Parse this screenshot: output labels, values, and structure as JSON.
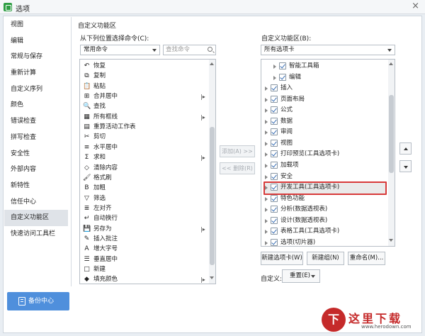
{
  "window": {
    "title": "选项",
    "close_glyph": "×"
  },
  "sidebar": {
    "items": [
      "视图",
      "编辑",
      "常规与保存",
      "重新计算",
      "自定义序列",
      "颜色",
      "错误检查",
      "拼写检查",
      "安全性",
      "外部内容",
      "新特性",
      "信任中心",
      "自定义功能区",
      "快速访问工具栏"
    ],
    "active": "自定义功能区",
    "backup_label": "备份中心"
  },
  "section_title": "自定义功能区",
  "left_panel": {
    "label": "从下列位置选择命令(C):",
    "source_value": "常用命令",
    "search_placeholder": "查找命令",
    "commands": [
      {
        "icon": "↶",
        "icon_name": "undo-icon",
        "label": "恢复"
      },
      {
        "icon": "⧉",
        "icon_name": "copy-icon",
        "label": "复制"
      },
      {
        "icon": "📋",
        "icon_name": "paste-icon",
        "label": "粘贴"
      },
      {
        "icon": "⊞",
        "icon_name": "merge-center-icon",
        "label": "合并居中",
        "sub": "|▸"
      },
      {
        "icon": "🔍",
        "icon_name": "find-icon",
        "label": "查找"
      },
      {
        "icon": "▦",
        "icon_name": "borders-icon",
        "label": "所有框线",
        "sub": "|▸"
      },
      {
        "icon": "▤",
        "icon_name": "recalc-sheet-icon",
        "label": "重算活动工作表"
      },
      {
        "icon": "✂",
        "icon_name": "cut-icon",
        "label": "剪切"
      },
      {
        "icon": "≡",
        "icon_name": "align-center-icon",
        "label": "水平居中"
      },
      {
        "icon": "Σ",
        "icon_name": "sum-icon",
        "label": "求和",
        "sub": "|▸"
      },
      {
        "icon": "◇",
        "icon_name": "clear-icon",
        "label": "清除内容"
      },
      {
        "icon": "🖌",
        "icon_name": "format-painter-icon",
        "label": "格式刷"
      },
      {
        "icon": "B",
        "icon_name": "bold-icon",
        "label": "加粗"
      },
      {
        "icon": "▽",
        "icon_name": "filter-icon",
        "label": "筛选"
      },
      {
        "icon": "≣",
        "icon_name": "align-left-icon",
        "label": "左对齐"
      },
      {
        "icon": "↵",
        "icon_name": "wrap-text-icon",
        "label": "自动换行"
      },
      {
        "icon": "💾",
        "icon_name": "save-as-icon",
        "label": "另存为",
        "sub": "|▸"
      },
      {
        "icon": "✎",
        "icon_name": "insert-comment-icon",
        "label": "插入批注"
      },
      {
        "icon": "A",
        "icon_name": "font-grow-icon",
        "label": "增大字号"
      },
      {
        "icon": "☰",
        "icon_name": "vertical-center-icon",
        "label": "垂直居中"
      },
      {
        "icon": "□",
        "icon_name": "new-icon",
        "label": "新建"
      },
      {
        "icon": "◆",
        "icon_name": "fill-color-icon",
        "label": "填充颜色",
        "sub": "|▸"
      }
    ]
  },
  "middle": {
    "add_label": "添加(A) >>",
    "remove_label": "<< 删除(R)"
  },
  "right_panel": {
    "label": "自定义功能区(B):",
    "scope_value": "所有选项卡",
    "tree": [
      {
        "label": "智能工具箱",
        "level": 1,
        "checked": true
      },
      {
        "label": "编辑",
        "level": 1,
        "checked": true
      },
      {
        "label": "插入",
        "level": 0,
        "checked": true
      },
      {
        "label": "页面布局",
        "level": 0,
        "checked": true
      },
      {
        "label": "公式",
        "level": 0,
        "checked": true
      },
      {
        "label": "数据",
        "level": 0,
        "checked": true
      },
      {
        "label": "审阅",
        "level": 0,
        "checked": true
      },
      {
        "label": "视图",
        "level": 0,
        "checked": true
      },
      {
        "label": "打印预览(工具选项卡)",
        "level": 0,
        "checked": true
      },
      {
        "label": "加载项",
        "level": 0,
        "checked": true
      },
      {
        "label": "安全",
        "level": 0,
        "checked": true
      },
      {
        "label": "开发工具(工具选项卡)",
        "level": 0,
        "checked": true,
        "highlighted": true
      },
      {
        "label": "特色功能",
        "level": 0,
        "checked": true
      },
      {
        "label": "分析(数据透视表)",
        "level": 0,
        "checked": true
      },
      {
        "label": "设计(数据透视表)",
        "level": 0,
        "checked": true
      },
      {
        "label": "表格工具(工具选项卡)",
        "level": 0,
        "checked": true
      },
      {
        "label": "选项(切片器)",
        "level": 0,
        "checked": true
      }
    ],
    "new_tab_label": "新建选项卡(W)",
    "new_group_label": "新建组(N)",
    "rename_label": "重命名(M)...",
    "custom_label": "自定义:",
    "reset_label": "重置(E)"
  },
  "watermark": {
    "logo_char": "下",
    "text": "这里下载",
    "url": "www.herodown.com"
  },
  "colors": {
    "accent": "#4f8fdc",
    "highlight_border": "#d83a3a",
    "watermark": "#c52a2a"
  }
}
